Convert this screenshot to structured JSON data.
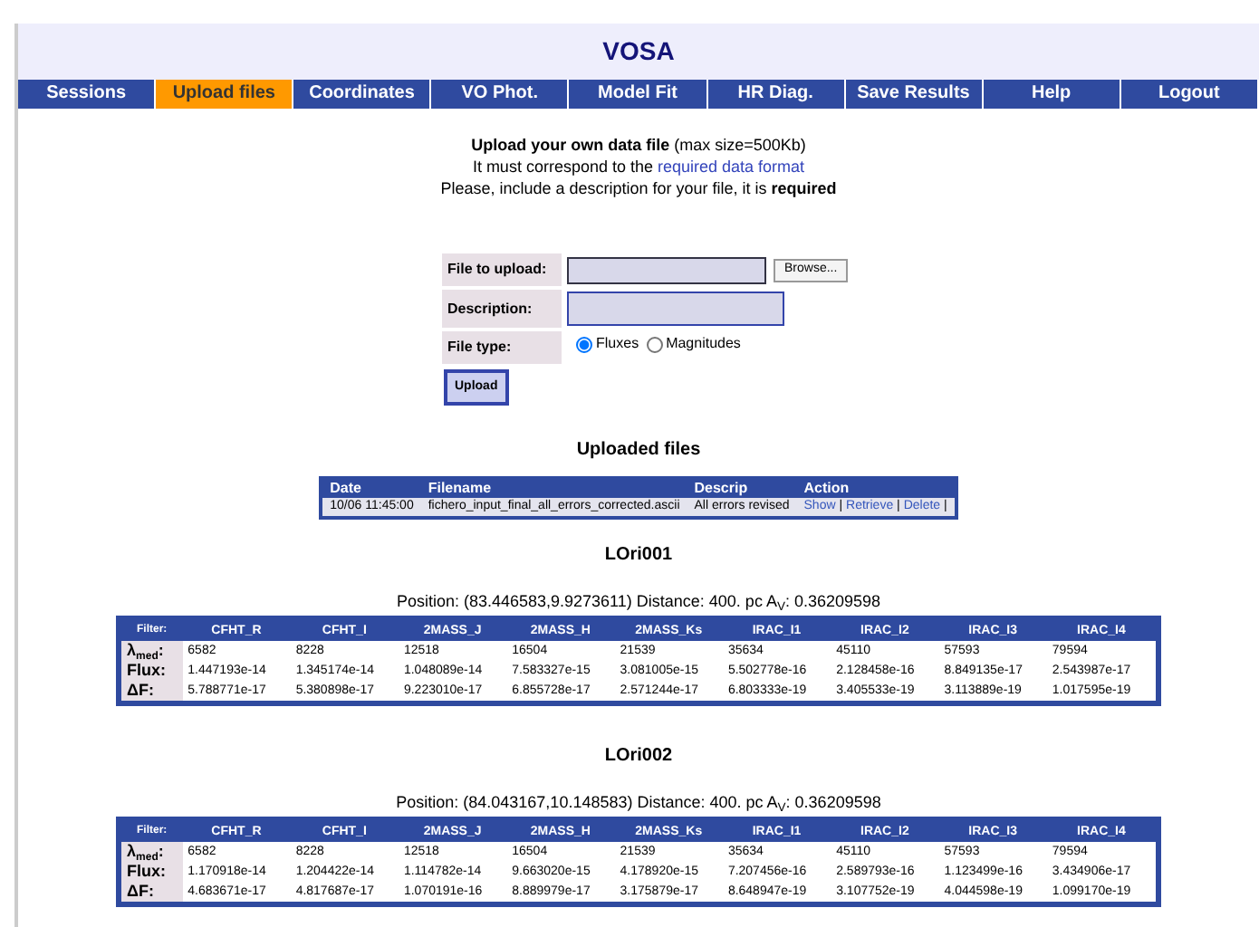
{
  "header": {
    "title": "VOSA"
  },
  "nav": [
    {
      "label": "Sessions",
      "selected": false
    },
    {
      "label": "Upload files",
      "selected": true
    },
    {
      "label": "Coordinates",
      "selected": false
    },
    {
      "label": "VO Phot.",
      "selected": false
    },
    {
      "label": "Model Fit",
      "selected": false
    },
    {
      "label": "HR Diag.",
      "selected": false
    },
    {
      "label": "Save Results",
      "selected": false
    },
    {
      "label": "Help",
      "selected": false
    },
    {
      "label": "Logout",
      "selected": false
    }
  ],
  "intro": {
    "line1": "**Upload your own data file** (max size=500Kb)",
    "line2_text": "It must correspond to the",
    "line2_link": "required data format",
    "line3": "Please, include a description for your file, it is **required**"
  },
  "form": {
    "file_label": "File to upload:",
    "browse_button": "Browse...",
    "description_label": "Description:",
    "type_label": "File type:",
    "file_types": [
      {
        "label": "Fluxes",
        "selected": true
      },
      {
        "label": "Magnitudes",
        "selected": false
      }
    ],
    "upload_button": "Upload"
  },
  "uploaded": {
    "title": "Uploaded files",
    "columns": [
      "Date",
      "Filename",
      "Descrip",
      "Action"
    ],
    "rows": [
      {
        "date": "10/06 11:45:00",
        "filename": "fichero_input_final_all_errors_corrected.ascii",
        "descrip": "All errors revised",
        "actions": [
          "Show",
          "Retrieve",
          "Delete"
        ],
        "separator": "|"
      }
    ]
  },
  "objects": [
    {
      "name": "LOri001",
      "position": "Position: (83.446583,9.9273611) Distance: 400. pc A$_{V}$: 0.36209598",
      "filter_label": "Filter:",
      "filters": [
        "CFHT_R",
        "CFHT_I",
        "2MASS_J",
        "2MASS_H",
        "2MASS_Ks",
        "IRAC_I1",
        "IRAC_I2",
        "IRAC_I3",
        "IRAC_I4"
      ],
      "rows": [
        {
          "label": "λ$_{med}$:",
          "values": [
            "6582",
            "8228",
            "12518",
            "16504",
            "21539",
            "35634",
            "45110",
            "57593",
            "79594"
          ]
        },
        {
          "label": "Flux:",
          "values": [
            "1.447193e-14",
            "1.345174e-14",
            "1.048089e-14",
            "7.583327e-15",
            "3.081005e-15",
            "5.502778e-16",
            "2.128458e-16",
            "8.849135e-17",
            "2.543987e-17"
          ]
        },
        {
          "label": "ΔF:",
          "values": [
            "5.788771e-17",
            "5.380898e-17",
            "9.223010e-17",
            "6.855728e-17",
            "2.571244e-17",
            "6.803333e-19",
            "3.405533e-19",
            "3.113889e-19",
            "1.017595e-19"
          ]
        }
      ]
    },
    {
      "name": "LOri002",
      "position": "Position: (84.043167,10.148583) Distance: 400. pc A$_{V}$: 0.36209598",
      "filter_label": "Filter:",
      "filters": [
        "CFHT_R",
        "CFHT_I",
        "2MASS_J",
        "2MASS_H",
        "2MASS_Ks",
        "IRAC_I1",
        "IRAC_I2",
        "IRAC_I3",
        "IRAC_I4"
      ],
      "rows": [
        {
          "label": "λ$_{med}$:",
          "values": [
            "6582",
            "8228",
            "12518",
            "16504",
            "21539",
            "35634",
            "45110",
            "57593",
            "79594"
          ]
        },
        {
          "label": "Flux:",
          "values": [
            "1.170918e-14",
            "1.204422e-14",
            "1.114782e-14",
            "9.663020e-15",
            "4.178920e-15",
            "7.207456e-16",
            "2.589793e-16",
            "1.123499e-16",
            "3.434906e-17"
          ]
        },
        {
          "label": "ΔF:",
          "values": [
            "4.683671e-17",
            "4.817687e-17",
            "1.070191e-16",
            "8.889979e-17",
            "3.175879e-17",
            "8.648947e-19",
            "3.107752e-19",
            "4.044598e-19",
            "1.099170e-19"
          ]
        }
      ]
    }
  ]
}
